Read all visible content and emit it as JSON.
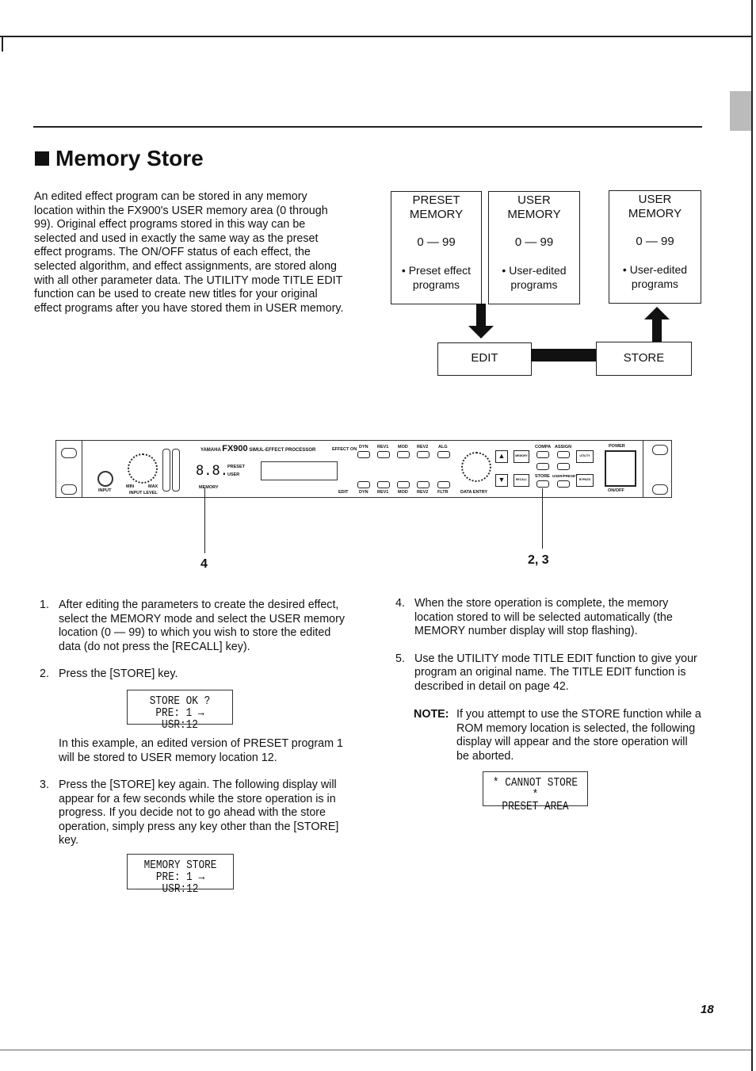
{
  "title": "Memory Store",
  "intro": "An edited effect program can be stored in any memory location within the FX900's USER memory area (0 through 99). Original effect programs stored in this way can be selected and used in exactly the same way as the preset effect programs. The ON/OFF status of each effect, the selected algorithm, and effect assignments, are stored along with all other parameter data. The UTILITY mode TITLE EDIT function can be used to create new titles for your original effect programs after you have stored them in USER memory.",
  "diagram": {
    "boxes": [
      {
        "line1": "PRESET",
        "line2": "MEMORY",
        "range": "0 — 99",
        "desc1": "• Preset effect",
        "desc2": "programs"
      },
      {
        "line1": "USER",
        "line2": "MEMORY",
        "range": "0 — 99",
        "desc1": "• User-edited",
        "desc2": "programs"
      },
      {
        "line1": "USER",
        "line2": "MEMORY",
        "range": "0 — 99",
        "desc1": "• User-edited",
        "desc2": "programs"
      }
    ],
    "edit": "EDIT",
    "store": "STORE"
  },
  "panel": {
    "brand": "YAMAHA",
    "model": "FX900",
    "subtitle": "SIMUL-EFFECT PROCESSOR",
    "input": "INPUT",
    "input_level": "INPUT LEVEL",
    "min": "MIN",
    "max": "MAX",
    "digits": "8.8.",
    "preset": "PRESET",
    "user": "USER",
    "memory": "MEMORY",
    "effect_on": "EFFECT ON",
    "edit": "EDIT",
    "effect_buttons": [
      "DYN",
      "REV1",
      "MOD",
      "REV2",
      "ALG"
    ],
    "edit_buttons": [
      "DYN",
      "REV1",
      "MOD",
      "REV2",
      "FLTR"
    ],
    "data_entry": "DATA ENTRY",
    "keys": {
      "memory": "MEMORY",
      "recall": "RECALL",
      "compa": "COMPA",
      "assign": "ASSIGN",
      "store": "STORE",
      "user_preset": "USER/PRESET",
      "utility": "UTILITY",
      "bypass": "BYPASS"
    },
    "power": "POWER",
    "on_off": "ON/OFF",
    "callout_left": "4",
    "callout_right": "2, 3"
  },
  "steps_left": [
    {
      "num": "1.",
      "text": "After editing the parameters to create the desired effect, select the MEMORY mode and select the USER memory location (0 — 99) to which you wish to store the edited data (do not press the [RECALL] key)."
    },
    {
      "num": "2.",
      "text": "Press the [STORE] key."
    },
    {
      "num": "3.",
      "text": "Press the [STORE] key again. The following display will appear for a few seconds while the store operation is in progress. If you decide not to go ahead with the store operation, simply press any key other than the [STORE] key."
    }
  ],
  "lcd1": {
    "line1": "STORE OK ?",
    "line2": "PRE: 1 → USR:12"
  },
  "example": "In this example, an edited version of PRESET program 1 will be stored to USER memory location 12.",
  "lcd2": {
    "line1": "MEMORY STORE",
    "line2": "PRE: 1 → USR:12"
  },
  "steps_right": [
    {
      "num": "4.",
      "text": "When the store operation is complete, the memory location stored to will be selected automatically (the MEMORY number display will stop flashing)."
    },
    {
      "num": "5.",
      "text": "Use the UTILITY mode TITLE EDIT function to give your program an original name. The TITLE EDIT function is described in detail on page 42."
    }
  ],
  "note": {
    "label": "NOTE:",
    "text": "If you attempt to use the STORE function while a ROM memory location is selected, the following display will appear and the store operation will be aborted."
  },
  "lcd3": {
    "line1": "* CANNOT STORE *",
    "line2": "PRESET AREA"
  },
  "page_number": "18"
}
